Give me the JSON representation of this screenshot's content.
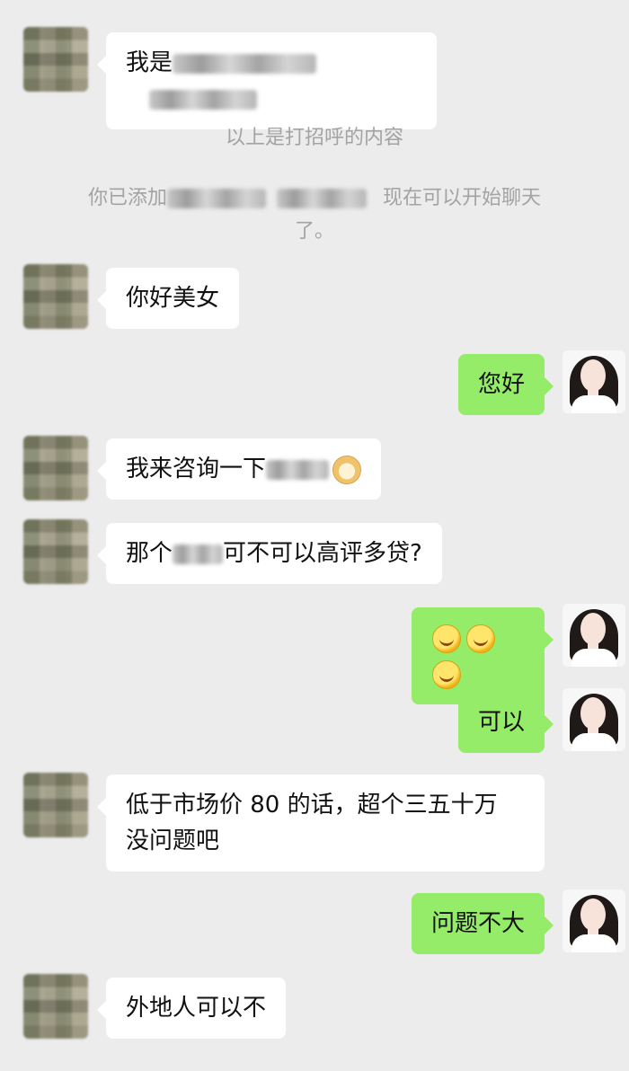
{
  "system": {
    "hello_notice": "以上是打招呼的内容",
    "added_prefix": "你已添加",
    "added_suffix": "现在可以开始聊天",
    "added_end": "了。"
  },
  "messages": [
    {
      "side": "left",
      "text_prefix": "我是"
    },
    {
      "side": "left",
      "text": "你好美女"
    },
    {
      "side": "right",
      "text": "您好"
    },
    {
      "side": "left",
      "text_prefix": "我来咨询一下"
    },
    {
      "side": "left",
      "text_prefix": "那个",
      "text_suffix": "可不可以高评多贷?"
    },
    {
      "side": "right",
      "emoji": [
        "laugh-emoji",
        "laugh-emoji",
        "laugh-emoji"
      ]
    },
    {
      "side": "right",
      "text": "可以"
    },
    {
      "side": "left",
      "line1": "低于市场价 80 的话，超个三五十万",
      "line2": "没问题吧"
    },
    {
      "side": "right",
      "text": "问题不大"
    },
    {
      "side": "left",
      "text": "外地人可以不"
    }
  ]
}
